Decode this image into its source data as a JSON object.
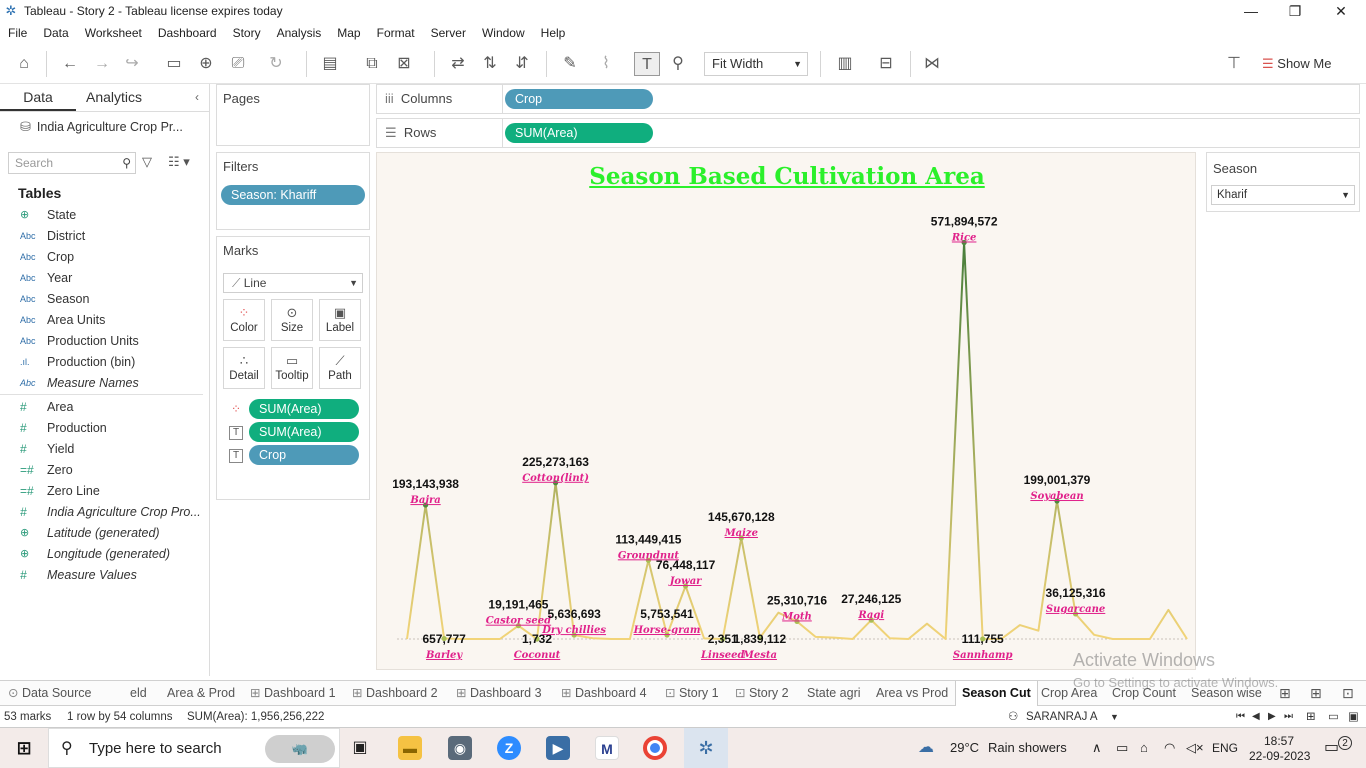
{
  "window": {
    "title": "Tableau - Story 2 - Tableau license expires today",
    "minimize": "—",
    "restore": "❐",
    "close": "✕"
  },
  "menu": [
    "File",
    "Data",
    "Worksheet",
    "Dashboard",
    "Story",
    "Analysis",
    "Map",
    "Format",
    "Server",
    "Window",
    "Help"
  ],
  "toolbar": {
    "fit": "Fit Width",
    "show_me": "Show Me"
  },
  "data_pane": {
    "tabs": [
      "Data",
      "Analytics"
    ],
    "datasource": "India Agriculture Crop Pr...",
    "search_placeholder": "Search",
    "tables_heading": "Tables",
    "dimensions": [
      {
        "type": "globe",
        "name": "State"
      },
      {
        "type": "Abc",
        "name": "District"
      },
      {
        "type": "Abc",
        "name": "Crop"
      },
      {
        "type": "Abc",
        "name": "Year"
      },
      {
        "type": "Abc",
        "name": "Season"
      },
      {
        "type": "Abc",
        "name": "Area Units"
      },
      {
        "type": "Abc",
        "name": "Production Units"
      },
      {
        "type": "bin",
        "name": "Production (bin)"
      },
      {
        "type": "Abc",
        "name": "Measure Names",
        "italic": true
      }
    ],
    "measures": [
      {
        "type": "#",
        "name": "Area"
      },
      {
        "type": "#",
        "name": "Production"
      },
      {
        "type": "#",
        "name": "Yield"
      },
      {
        "type": "calc",
        "name": "Zero"
      },
      {
        "type": "calc",
        "name": "Zero Line"
      },
      {
        "type": "#",
        "name": "India Agriculture Crop Pro...",
        "italic": true
      },
      {
        "type": "globe",
        "name": "Latitude (generated)",
        "italic": true
      },
      {
        "type": "globe",
        "name": "Longitude (generated)",
        "italic": true
      },
      {
        "type": "#",
        "name": "Measure Values",
        "italic": true
      }
    ]
  },
  "pages": {
    "heading": "Pages"
  },
  "filters": {
    "heading": "Filters",
    "pill": "Season: Khariff"
  },
  "marks": {
    "heading": "Marks",
    "type": "Line",
    "buttons": [
      "Color",
      "Size",
      "Label",
      "Detail",
      "Tooltip",
      "Path"
    ],
    "pills": [
      "SUM(Area)",
      "SUM(Area)",
      "Crop"
    ]
  },
  "shelves": {
    "columns_label": "Columns",
    "columns_pill": "Crop",
    "rows_label": "Rows",
    "rows_pill": "SUM(Area)"
  },
  "season_filter": {
    "heading": "Season",
    "value": "Kharif"
  },
  "chart_data": {
    "type": "line",
    "title": "Season Based Cultivation Area",
    "ylim": [
      0,
      600000000
    ],
    "line_colors": {
      "low": "#f2d479",
      "high": "#3f7a38"
    },
    "label_value_color": "#111111",
    "label_crop_color": "#e0208a",
    "values": [
      0,
      193143938,
      657777,
      0,
      0,
      0,
      19191465,
      1732,
      225273163,
      5636693,
      1200000,
      0,
      0,
      113449415,
      5753541,
      76448117,
      900000,
      2351,
      145670128,
      1839112,
      38000000,
      25310716,
      3000000,
      2000000,
      0,
      27246125,
      1000000,
      0,
      22000000,
      0,
      571894572,
      111755,
      0,
      20000000,
      12000000,
      199001379,
      36125316,
      6000000,
      0,
      0,
      0,
      42000000,
      0
    ],
    "labels": [
      {
        "i": 1,
        "value": "193,143,938",
        "crop": "Bajra"
      },
      {
        "i": 2,
        "value": "657,777",
        "crop": "Barley"
      },
      {
        "i": 6,
        "value": "19,191,465",
        "crop": "Castor seed"
      },
      {
        "i": 7,
        "value": "1,732",
        "crop": "Coconut"
      },
      {
        "i": 8,
        "value": "225,273,163",
        "crop": "Cotton(lint)"
      },
      {
        "i": 9,
        "value": "5,636,693",
        "crop": "Dry chillies"
      },
      {
        "i": 13,
        "value": "113,449,415",
        "crop": "Groundnut"
      },
      {
        "i": 14,
        "value": "5,753,541",
        "crop": "Horse-gram"
      },
      {
        "i": 15,
        "value": "76,448,117",
        "crop": "Jowar"
      },
      {
        "i": 17,
        "value": "2,351",
        "crop": "Linseed"
      },
      {
        "i": 18,
        "value": "145,670,128",
        "crop": "Maize"
      },
      {
        "i": 19,
        "value": "1,839,112",
        "crop": "Mesta"
      },
      {
        "i": 21,
        "value": "25,310,716",
        "crop": "Moth"
      },
      {
        "i": 25,
        "value": "27,246,125",
        "crop": "Ragi"
      },
      {
        "i": 30,
        "value": "571,894,572",
        "crop": "Rice"
      },
      {
        "i": 31,
        "value": "111,755",
        "crop": "Sannhamp"
      },
      {
        "i": 35,
        "value": "199,001,379",
        "crop": "Soyabean"
      },
      {
        "i": 36,
        "value": "36,125,316",
        "crop": "Sugarcane"
      }
    ]
  },
  "sheet_tabs": [
    "Data Source",
    "eld",
    "Area & Prod",
    "Dashboard 1",
    "Dashboard 2",
    "Dashboard 3",
    "Dashboard 4",
    "Story 1",
    "Story 2",
    "State agri",
    "Area vs Prod",
    "Season Cut",
    "Crop Area",
    "Crop Count",
    "Season wise"
  ],
  "active_tab": "Season Cut",
  "watermark": {
    "line1": "Activate Windows",
    "line2": "Go to Settings to activate Windows."
  },
  "status": {
    "marks": "53 marks",
    "rows": "1 row by 54 columns",
    "sum": "SUM(Area): 1,956,256,222",
    "user": "SARANRAJ A"
  },
  "taskbar": {
    "search": "Type here to search",
    "weather_temp": "29°C",
    "weather_desc": "Rain showers",
    "lang": "ENG",
    "time": "18:57",
    "date": "22-09-2023",
    "notifications": "2"
  }
}
